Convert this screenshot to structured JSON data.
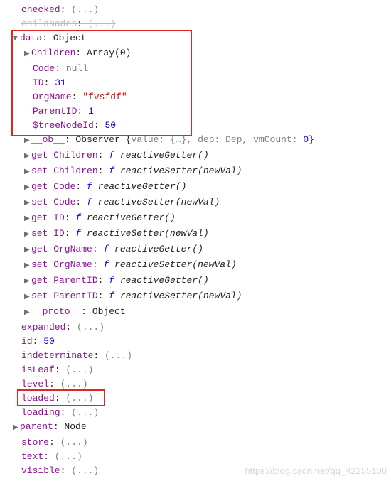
{
  "ellipsis": "(...)",
  "colon": ": ",
  "comma": ", ",
  "tri_closed": "▶",
  "tri_open": "▼",
  "checked": {
    "label": "checked"
  },
  "childNodes": {
    "label": "childNodes"
  },
  "data": {
    "label": "data",
    "type": "Object",
    "Children": {
      "label": "Children",
      "type": "Array(0)"
    },
    "Code": {
      "label": "Code",
      "value": "null"
    },
    "ID": {
      "label": "ID",
      "value": "31"
    },
    "OrgName": {
      "label": "OrgName",
      "value": "\"fvsfdf\""
    },
    "ParentID": {
      "label": "ParentID",
      "value": "1"
    },
    "treeNodeId": {
      "label": "$treeNodeId",
      "value": "50"
    },
    "ob": {
      "label": "__ob__",
      "type": "Observer",
      "valueKey": "value",
      "valueText": "{…}",
      "depKey": "dep",
      "depText": "Dep",
      "vmCountKey": "vmCount",
      "vmCountText": "0"
    },
    "getters": [
      {
        "name": "get Children",
        "fn": "reactiveGetter()"
      },
      {
        "name": "set Children",
        "fn": "reactiveSetter(newVal)"
      },
      {
        "name": "get Code",
        "fn": "reactiveGetter()"
      },
      {
        "name": "set Code",
        "fn": "reactiveSetter(newVal)"
      },
      {
        "name": "get ID",
        "fn": "reactiveGetter()"
      },
      {
        "name": "set ID",
        "fn": "reactiveSetter(newVal)"
      },
      {
        "name": "get OrgName",
        "fn": "reactiveGetter()"
      },
      {
        "name": "set OrgName",
        "fn": "reactiveSetter(newVal)"
      },
      {
        "name": "get ParentID",
        "fn": "reactiveGetter()"
      },
      {
        "name": "set ParentID",
        "fn": "reactiveSetter(newVal)"
      }
    ],
    "proto": {
      "label": "__proto__",
      "value": "Object"
    }
  },
  "rest": {
    "expanded": {
      "label": "expanded"
    },
    "id": {
      "label": "id",
      "value": "50"
    },
    "indeterminate": {
      "label": "indeterminate"
    },
    "isLeaf": {
      "label": "isLeaf"
    },
    "level": {
      "label": "level"
    },
    "loaded": {
      "label": "loaded"
    },
    "loading": {
      "label": "loading"
    },
    "parent": {
      "label": "parent",
      "value": "Node"
    },
    "store": {
      "label": "store"
    },
    "text": {
      "label": "text"
    },
    "visible": {
      "label": "visible"
    }
  },
  "watermark": "https://blog.csdn.net/qq_42255106"
}
